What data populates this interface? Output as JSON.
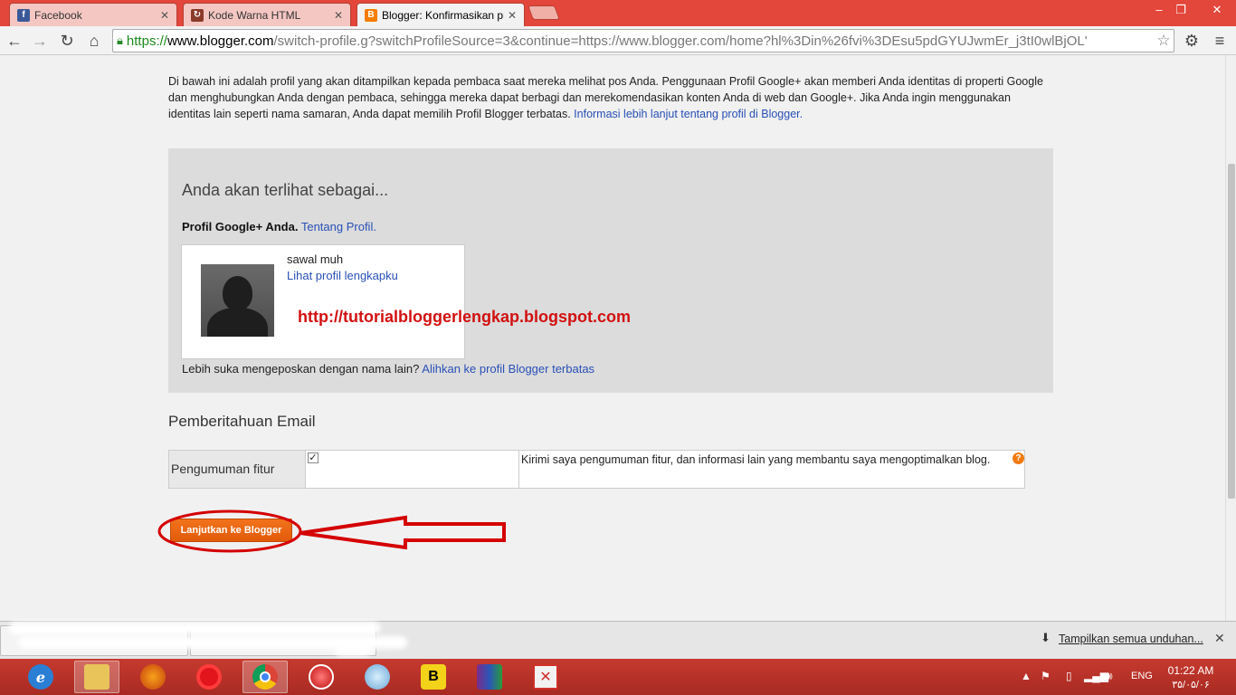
{
  "browser": {
    "tabs": [
      {
        "label": "Facebook",
        "icon": "facebook-icon",
        "active": false
      },
      {
        "label": "Kode Warna HTML",
        "icon": "site-icon",
        "active": false
      },
      {
        "label": "Blogger: Konfirmasikan pr",
        "icon": "blogger-icon",
        "active": true
      }
    ],
    "url_scheme": "https://",
    "url_host": "www.blogger.com",
    "url_path": "/switch-profile.g?switchProfileSource=3&continue=https://www.blogger.com/home?hl%3Din%26fvi%3DEsu5pdGYUJwmEr_j3tI0wlBjOL'",
    "window_buttons": {
      "minimize": "–",
      "restore": "❐",
      "close": "✕"
    }
  },
  "page": {
    "intro_text": "Di bawah ini adalah profil yang akan ditampilkan kepada pembaca saat mereka melihat pos Anda. Penggunaan Profil Google+ akan memberi Anda identitas di properti Google dan menghubungkan Anda dengan pembaca, sehingga mereka dapat berbagi dan merekomendasikan konten Anda di web dan Google+. Jika Anda ingin menggunakan identitas lain seperti nama samaran, Anda dapat memilih Profil Blogger terbatas.",
    "intro_link": "Informasi lebih lanjut tentang profil di Blogger.",
    "seen_as_heading": "Anda akan terlihat sebagai...",
    "gplus_label": "Profil Google+ Anda.",
    "gplus_link": "Tentang Profil.",
    "profile_name": "sawal muh",
    "profile_link": "Lihat profil lengkapku",
    "watermark_url": "http://tutorialbloggerlengkap.blogspot.com",
    "switch_text": "Lebih suka mengeposkan dengan nama lain?",
    "switch_link": "Alihkan ke profil Blogger terbatas",
    "email_heading": "Pemberitahuan Email",
    "email_row_label": "Pengumuman fitur",
    "email_row_checked": true,
    "email_row_desc": "Kirimi saya pengumuman fitur, dan informasi lain yang membantu saya mengoptimalkan blog.",
    "continue_button": "Lanjutkan ke Blogger",
    "accent_color": "#e8620f",
    "annotation_color": "#d40000"
  },
  "downloads": {
    "show_all": "Tampilkan semua unduhan..."
  },
  "taskbar": {
    "language": "ENG",
    "time": "01:22 AM",
    "date": "۳۵/۰۵/۰۶"
  }
}
